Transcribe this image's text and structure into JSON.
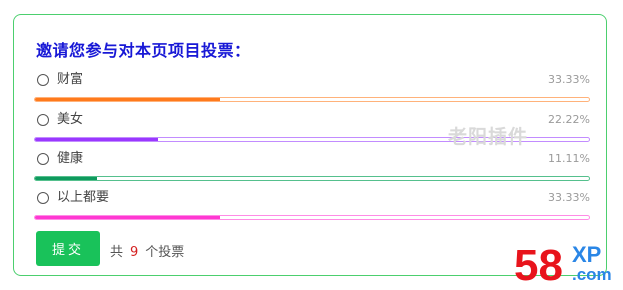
{
  "poll": {
    "title": "邀请您参与对本页项目投票：",
    "options": [
      {
        "label": "财富",
        "percent_text": "33.33%",
        "value": 0.3333,
        "color": "#ff7a1c",
        "track_color": "#ffb27a"
      },
      {
        "label": "美女",
        "percent_text": "22.22%",
        "value": 0.2222,
        "color": "#9a38ff",
        "track_color": "#c28cff"
      },
      {
        "label": "健康",
        "percent_text": "11.11%",
        "value": 0.1111,
        "color": "#0f9a5e",
        "track_color": "#55c08d"
      },
      {
        "label": "以上都要",
        "percent_text": "33.33%",
        "value": 0.3333,
        "color": "#ff38d2",
        "track_color": "#ff8ce6"
      }
    ],
    "submit_label": "提交",
    "total_prefix": "共",
    "total_count": "9",
    "total_suffix": "个投票"
  },
  "watermark": {
    "text": "老阳插件",
    "logo_text": "58",
    "logo_suffix": "XP",
    "logo_domain": ".com"
  },
  "colors": {
    "border": "#4ccf6e",
    "title": "#1818d6",
    "button": "#19c25a",
    "count": "#d42020",
    "logo_red": "#e8141c",
    "logo_blue": "#2a86e6"
  }
}
